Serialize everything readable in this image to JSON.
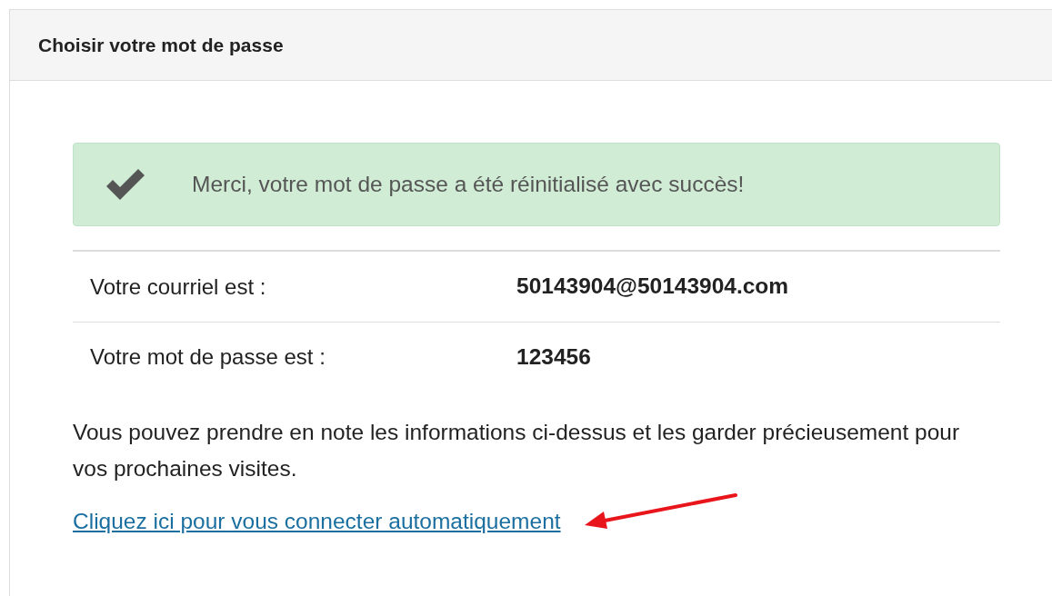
{
  "card": {
    "title": "Choisir votre mot de passe"
  },
  "alert": {
    "kind": "success",
    "message": "Merci, votre mot de passe a été réinitialisé avec succès!"
  },
  "details": [
    {
      "label": "Votre courriel est :",
      "value": "50143904@50143904.com"
    },
    {
      "label": "Votre mot de passe est :",
      "value": "123456"
    }
  ],
  "note": "Vous pouvez prendre en note les informations ci-dessus et les garder précieusement pour vos prochaines visites.",
  "link": "Cliquez ici pour vous connecter automatiquement"
}
